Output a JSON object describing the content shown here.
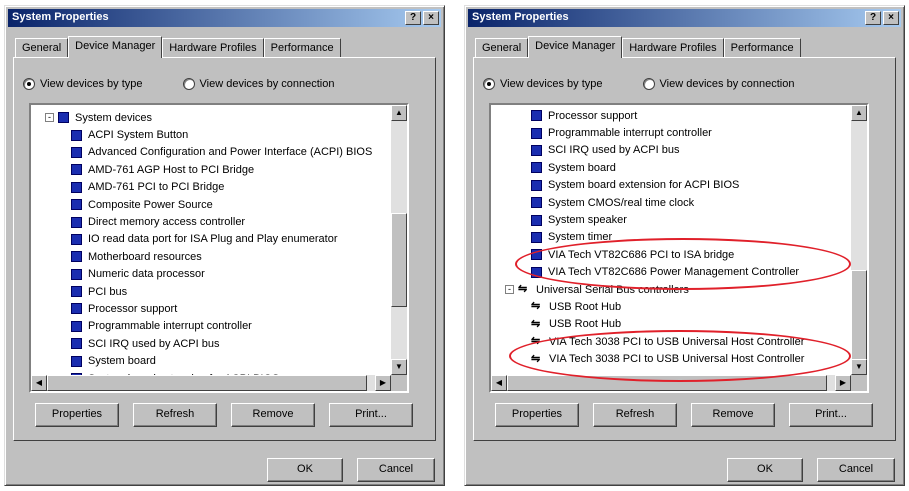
{
  "left": {
    "title": "System Properties",
    "tabs": [
      "General",
      "Device Manager",
      "Hardware Profiles",
      "Performance"
    ],
    "radio_type": "View devices by type",
    "radio_connection": "View devices by connection",
    "tree": [
      {
        "label": "System devices",
        "level": 0,
        "expander": "-"
      },
      {
        "label": "ACPI System Button",
        "level": 1
      },
      {
        "label": "Advanced Configuration and Power Interface (ACPI) BIOS",
        "level": 1
      },
      {
        "label": "AMD-761 AGP Host to PCI Bridge",
        "level": 1
      },
      {
        "label": "AMD-761 PCI to PCI Bridge",
        "level": 1
      },
      {
        "label": "Composite Power Source",
        "level": 1
      },
      {
        "label": "Direct memory access controller",
        "level": 1
      },
      {
        "label": "IO read data port for ISA Plug and Play enumerator",
        "level": 1
      },
      {
        "label": "Motherboard resources",
        "level": 1
      },
      {
        "label": "Numeric data processor",
        "level": 1
      },
      {
        "label": "PCI bus",
        "level": 1
      },
      {
        "label": "Processor support",
        "level": 1
      },
      {
        "label": "Programmable interrupt controller",
        "level": 1
      },
      {
        "label": "SCI IRQ used by ACPI bus",
        "level": 1
      },
      {
        "label": "System board",
        "level": 1
      },
      {
        "label": "System board extension for ACPI BIOS",
        "level": 1
      }
    ],
    "buttons": {
      "properties": "Properties",
      "refresh": "Refresh",
      "remove": "Remove",
      "print": "Print..."
    },
    "ok": "OK",
    "cancel": "Cancel"
  },
  "right": {
    "title": "System Properties",
    "tabs": [
      "General",
      "Device Manager",
      "Hardware Profiles",
      "Performance"
    ],
    "radio_type": "View devices by type",
    "radio_connection": "View devices by connection",
    "tree": [
      {
        "label": "Processor support",
        "level": 1
      },
      {
        "label": "Programmable interrupt controller",
        "level": 1
      },
      {
        "label": "SCI IRQ used by ACPI bus",
        "level": 1
      },
      {
        "label": "System board",
        "level": 1
      },
      {
        "label": "System board extension for ACPI BIOS",
        "level": 1
      },
      {
        "label": "System CMOS/real time clock",
        "level": 1
      },
      {
        "label": "System speaker",
        "level": 1
      },
      {
        "label": "System timer",
        "level": 1
      },
      {
        "label": "VIA Tech VT82C686 PCI to ISA bridge",
        "level": 1
      },
      {
        "label": "VIA Tech VT82C686 Power Management Controller",
        "level": 1
      },
      {
        "label": "Universal Serial Bus controllers",
        "level": 0,
        "expander": "-",
        "usb": true
      },
      {
        "label": "USB Root Hub",
        "level": 1,
        "usb": true
      },
      {
        "label": "USB Root Hub",
        "level": 1,
        "usb": true
      },
      {
        "label": "VIA Tech 3038 PCI to USB Universal Host Controller",
        "level": 1,
        "usb": true
      },
      {
        "label": "VIA Tech 3038 PCI to USB Universal Host Controller",
        "level": 1,
        "usb": true
      }
    ],
    "buttons": {
      "properties": "Properties",
      "refresh": "Refresh",
      "remove": "Remove",
      "print": "Print..."
    },
    "ok": "OK",
    "cancel": "Cancel"
  },
  "colors": {
    "highlight_ellipse": "#e0202a",
    "titlebar_start": "#0a246a",
    "titlebar_end": "#a6caf0",
    "device_icon": "#1a2db0"
  }
}
